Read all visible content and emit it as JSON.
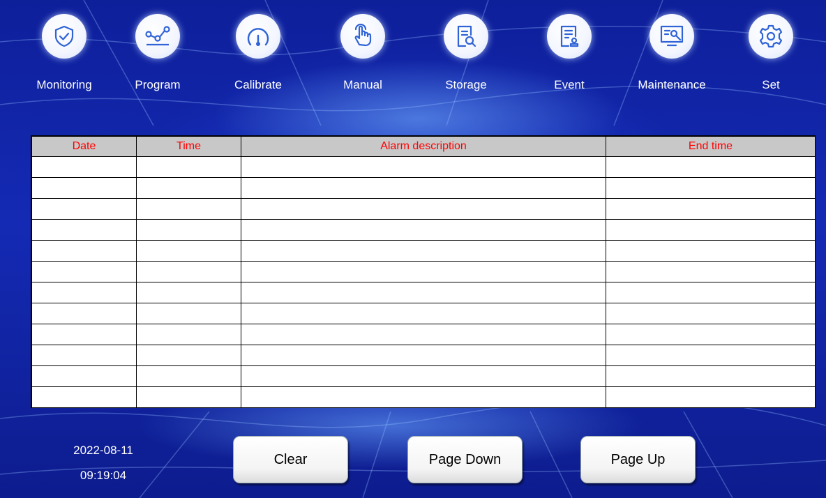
{
  "nav": [
    {
      "label": "Monitoring",
      "icon": "shield-check-icon"
    },
    {
      "label": "Program",
      "icon": "program-curve-icon"
    },
    {
      "label": "Calibrate",
      "icon": "gauge-icon"
    },
    {
      "label": "Manual",
      "icon": "hand-pointer-icon"
    },
    {
      "label": "Storage",
      "icon": "document-search-icon"
    },
    {
      "label": "Event",
      "icon": "document-stamp-icon"
    },
    {
      "label": "Maintenance",
      "icon": "monitor-wrench-icon"
    },
    {
      "label": "Set",
      "icon": "gear-icon"
    }
  ],
  "table": {
    "columns": [
      "Date",
      "Time",
      "Alarm description",
      "End time"
    ],
    "rows": [
      [
        "",
        "",
        "",
        ""
      ],
      [
        "",
        "",
        "",
        ""
      ],
      [
        "",
        "",
        "",
        ""
      ],
      [
        "",
        "",
        "",
        ""
      ],
      [
        "",
        "",
        "",
        ""
      ],
      [
        "",
        "",
        "",
        ""
      ],
      [
        "",
        "",
        "",
        ""
      ],
      [
        "",
        "",
        "",
        ""
      ],
      [
        "",
        "",
        "",
        ""
      ],
      [
        "",
        "",
        "",
        ""
      ],
      [
        "",
        "",
        "",
        ""
      ],
      [
        "",
        "",
        "",
        ""
      ]
    ]
  },
  "footer": {
    "date": "2022-08-11",
    "time": "09:19:04",
    "clear_label": "Clear",
    "page_down_label": "Page Down",
    "page_up_label": "Page Up"
  },
  "colors": {
    "background": "#142ab4",
    "header_text": "#ff0000",
    "header_bg": "#c8c8c8"
  }
}
